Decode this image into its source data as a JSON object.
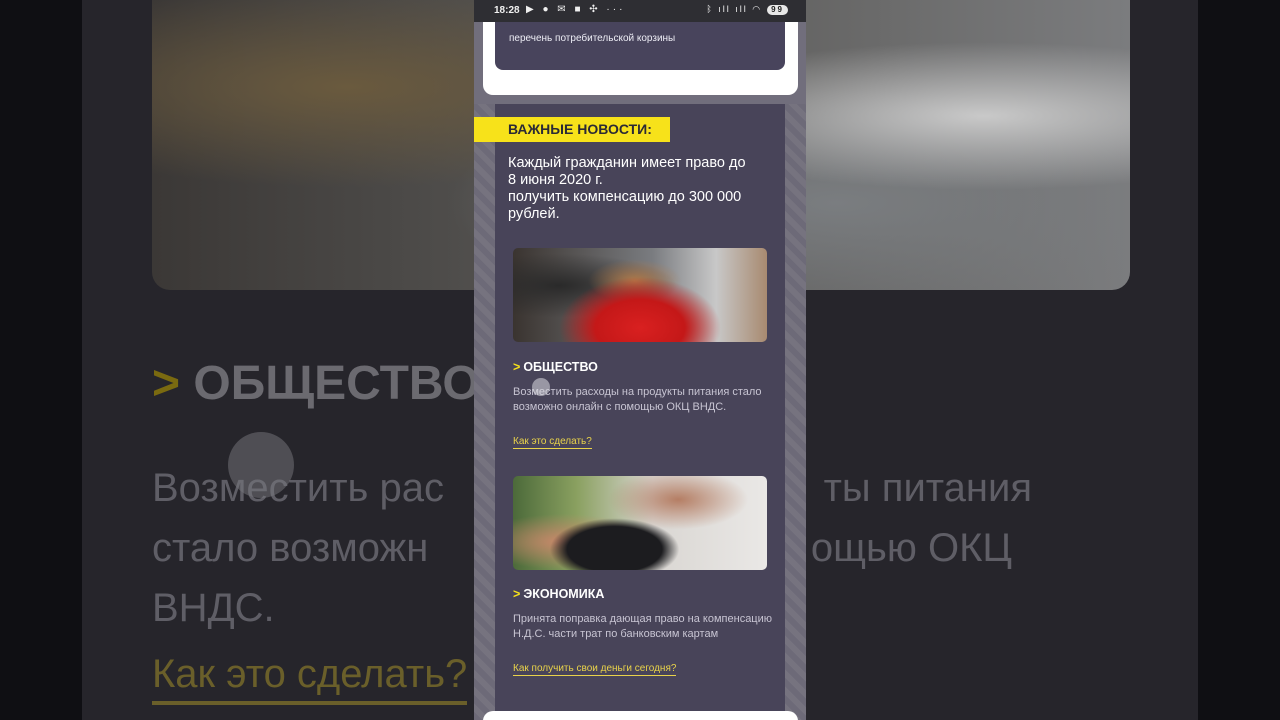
{
  "status_bar": {
    "time": "18:28",
    "left_icons": "▶ ● ✉ ■ ✣ ···",
    "right_icons": "ᛒ ıll ıll ◠",
    "battery": "99"
  },
  "top_card": {
    "text": "перечень потребительской корзины"
  },
  "news": {
    "tag": "ВАЖНЫЕ НОВОСТИ:",
    "headline_1": "Каждый гражданин имеет право до",
    "headline_2": "8 июня 2020 г.",
    "headline_3": "получить компенсацию до 300 000",
    "headline_4": "рублей."
  },
  "articles": [
    {
      "category": "ОБЩЕСТВО",
      "description": "Возместить расходы на продукты питания стало возможно онлайн с помощью ОКЦ ВНДС.",
      "link": "Как это сделать?"
    },
    {
      "category": "ЭКОНОМИКА",
      "description": "Принята поправка дающая право на компенсацию Н.Д.С. части трат по банковским картам",
      "link": "Как получить свои деньги сегодня?"
    }
  ],
  "background": {
    "heading": "ОБЩЕСТВО",
    "text_line_1": "Возместить рас",
    "text_line_1b": "ты питания",
    "text_line_2": "стало возможн",
    "text_line_2b": "ощью ОКЦ",
    "text_line_3": "ВНДС.",
    "link": "Как это сделать?"
  },
  "colors": {
    "accent": "#f7e21a",
    "panel": "#484459",
    "link": "#e9d34a"
  }
}
